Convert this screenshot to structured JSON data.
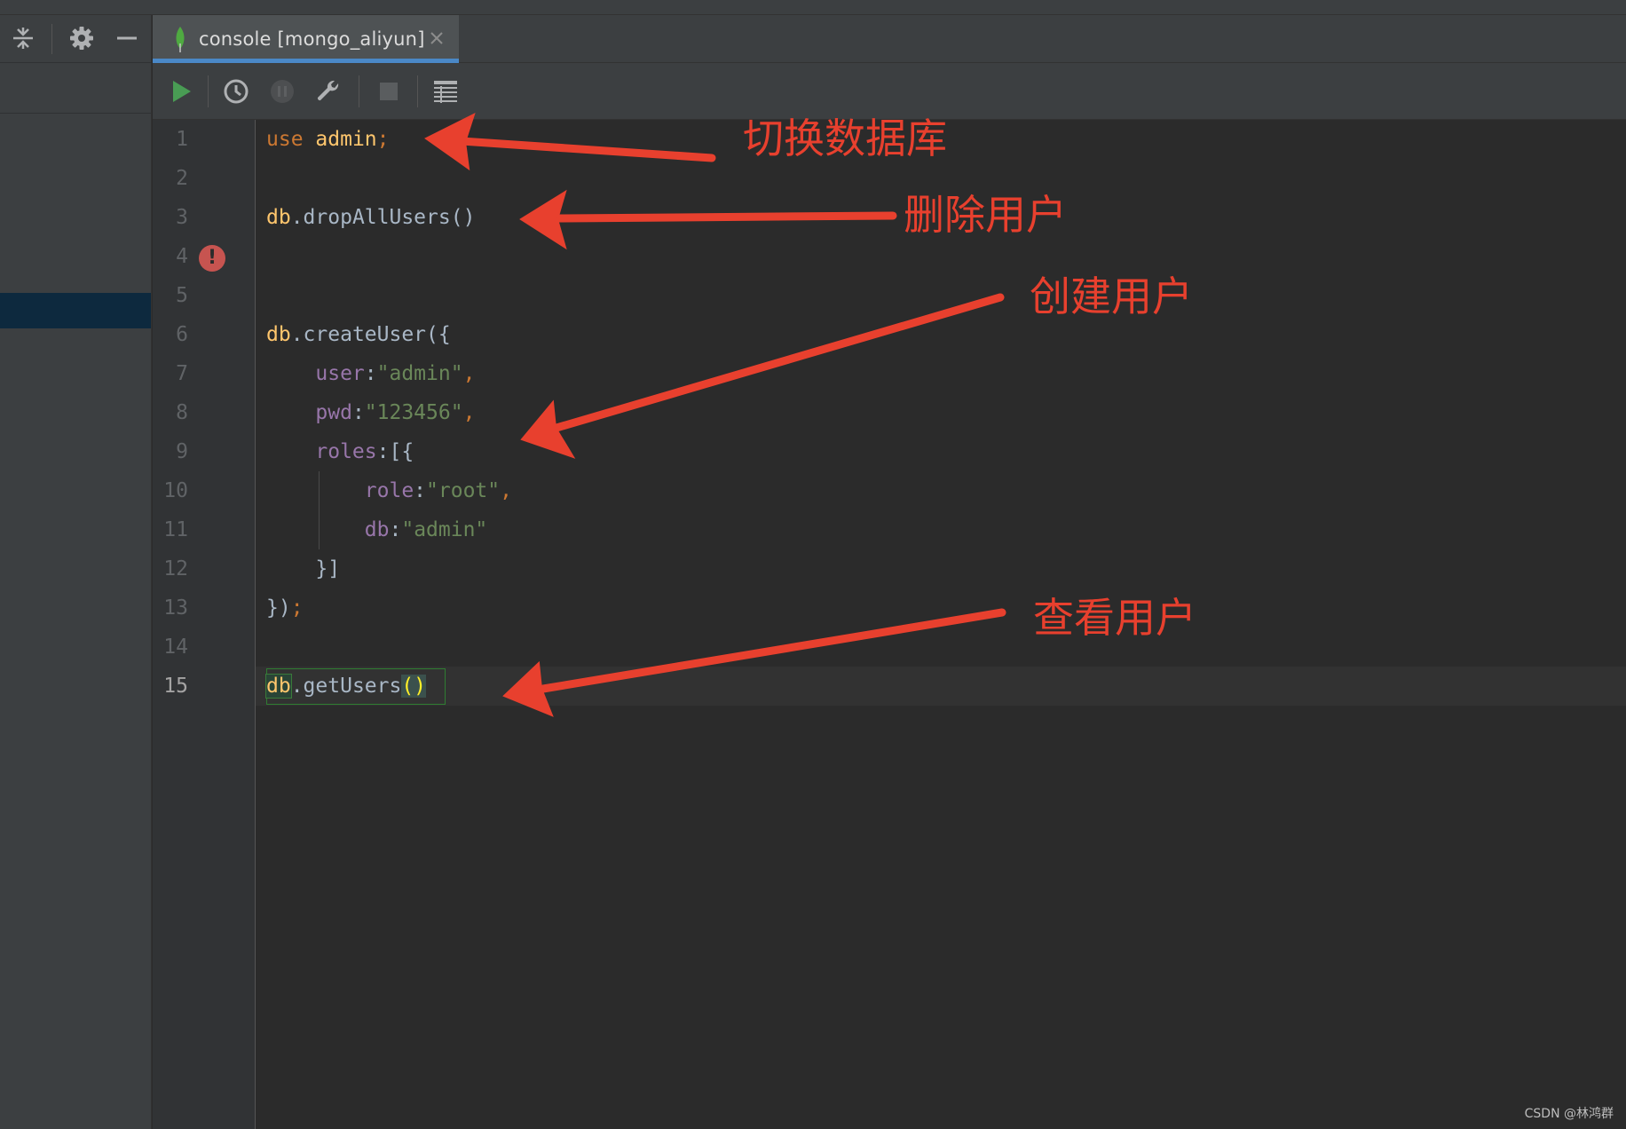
{
  "tab": {
    "label": "console [mongo_aliyun]"
  },
  "sidebar": {
    "icons": [
      "collapse-all-icon",
      "gear-icon",
      "minimize-icon"
    ]
  },
  "toolbar": {
    "icons": [
      "run-icon",
      "history-icon",
      "pause-icon",
      "wrench-icon",
      "stop-icon",
      "table-icon"
    ]
  },
  "editor": {
    "line_numbers": [
      "1",
      "2",
      "3",
      "4",
      "5",
      "6",
      "7",
      "8",
      "9",
      "10",
      "11",
      "12",
      "13",
      "14",
      "15"
    ],
    "current_line": "15",
    "error_line": "4",
    "error_glyph": "!",
    "code": {
      "l1_kw": "use",
      "l1_ident": "admin",
      "l1_semi": ";",
      "l3_db": "db",
      "l3_rest": ".dropAllUsers()",
      "l6_db": "db",
      "l6_rest": ".createUser({",
      "l7_prop": "user",
      "l7_colon": ":",
      "l7_str": "\"admin\"",
      "l7_comma": ",",
      "l8_prop": "pwd",
      "l8_colon": ":",
      "l8_str": "\"123456\"",
      "l8_comma": ",",
      "l9_prop": "roles",
      "l9_rest": ":[{",
      "l10_prop": "role",
      "l10_colon": ":",
      "l10_str": "\"root\"",
      "l10_comma": ",",
      "l11_prop": "db",
      "l11_colon": ":",
      "l11_str": "\"admin\"",
      "l12": "}]",
      "l13_close": "})",
      "l13_semi": ";",
      "l15_db": "db",
      "l15_fn": ".getUsers",
      "l15_paren": "()"
    }
  },
  "annotations": {
    "switch_db": "切换数据库",
    "drop_users": "删除用户",
    "create_user": "创建用户",
    "view_users": "查看用户"
  },
  "colors": {
    "annotation": "#e8402e",
    "tab_underline": "#4a88c7",
    "run_green": "#499c54",
    "error_red": "#c75450"
  },
  "watermark": "CSDN @林鸿群"
}
